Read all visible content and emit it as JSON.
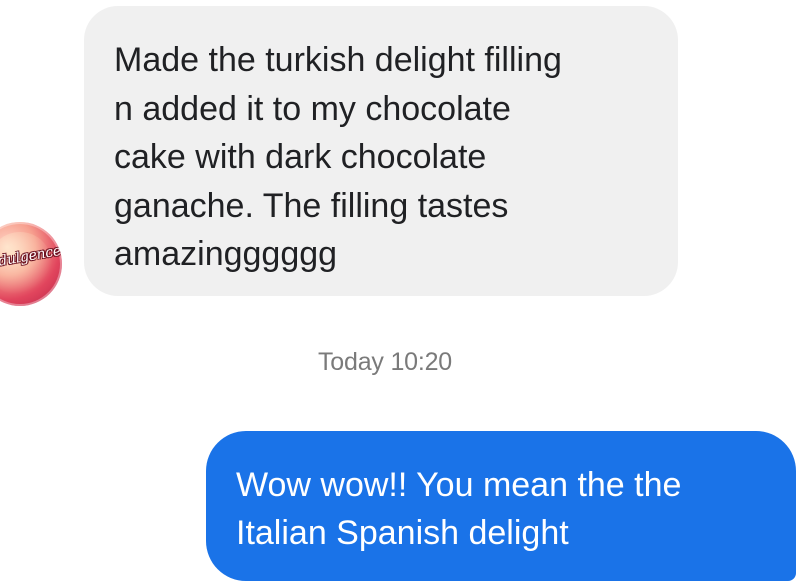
{
  "conversation": {
    "incoming": {
      "sender_avatar_icon": "indulgence-logo-avatar",
      "avatar_logo_text": "Indulgence",
      "lines": [
        "Made the turkish delight filling",
        "n added it to my chocolate",
        "cake with dark chocolate",
        "ganache. The filling tastes",
        "amazingggggg"
      ]
    },
    "timestamp": "Today 10:20",
    "outgoing": {
      "lines": [
        "Wow wow!! You mean the the",
        "Italian Spanish delight"
      ]
    }
  },
  "colors": {
    "incoming_bubble": "#f0f0f0",
    "outgoing_bubble": "#1a73e8",
    "timestamp_text": "#7a7a7a"
  }
}
